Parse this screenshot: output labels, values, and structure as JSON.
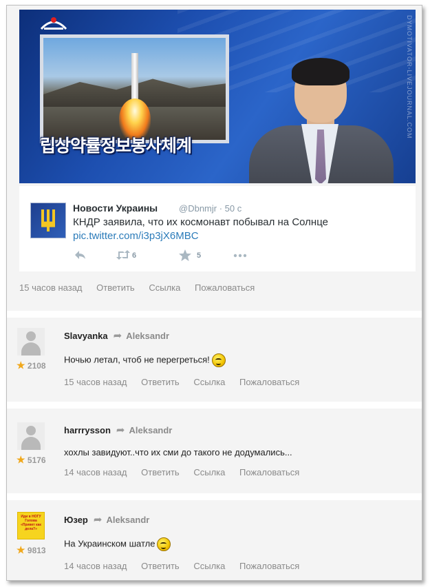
{
  "news_image": {
    "caption": "립상약률정보봉사체계",
    "watermark": "DYMOTIVATOR-LIVEJOURNAL.COM"
  },
  "tweet": {
    "author": "Новости Украины",
    "handle": "@Dbnmjr · 50 с",
    "text": "КНДР заявила, что их космонавт побывал на Солнце",
    "link": "pic.twitter.com/i3p3jX6MBC",
    "retweets": "6",
    "favorites": "5"
  },
  "post_actions": {
    "time": "15 часов назад",
    "reply": "Ответить",
    "link": "Ссылка",
    "report": "Пожаловаться"
  },
  "comments": [
    {
      "author": "Slavyanka",
      "reply_to": "Aleksandr",
      "rating": "2108",
      "text": "Ночью летал, чтоб не перегреться!",
      "time": "15 часов назад",
      "reply": "Ответить",
      "link": "Ссылка",
      "report": "Пожаловаться"
    },
    {
      "author": "harrrysson",
      "reply_to": "Aleksandr",
      "rating": "5176",
      "text": "хохлы завидуют..что их сми до такого не додумались...",
      "time": "14 часов назад",
      "reply": "Ответить",
      "link": "Ссылка",
      "report": "Пожаловаться"
    },
    {
      "author": "Юзер",
      "reply_to": "Aleksandr",
      "rating": "9813",
      "text": "На Украинском шатле",
      "avatar_text": "Иди в НОГУ Голова «Привет как дела?»",
      "time": "14 часов назад",
      "reply": "Ответить",
      "link": "Ссылка",
      "report": "Пожаловаться"
    }
  ],
  "icons": {
    "reply": "reply-arrow-icon",
    "retweet": "retweet-icon",
    "favorite": "star-icon",
    "more": "more-dots-icon",
    "rating": "rating-star-icon",
    "reply_to": "reply-to-arrow-icon"
  },
  "colors": {
    "link_blue": "#2b7bb9",
    "rating_star": "#f0a81c",
    "muted_text": "#8a8a8a"
  }
}
